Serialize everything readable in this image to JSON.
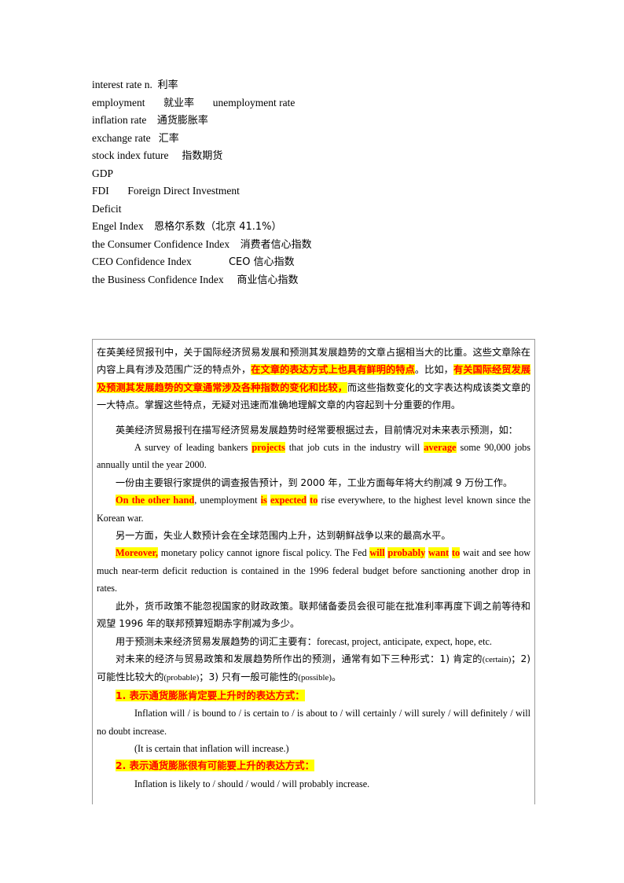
{
  "document": {
    "vocabulary": {
      "lines": [
        {
          "en": "interest rate n.",
          "sep": "  ",
          "cn": "利率",
          "tail_en": ""
        },
        {
          "en": "employment",
          "sep": "       ",
          "cn": "就业率",
          "tail_en": "       unemployment rate"
        },
        {
          "en": "inflation rate",
          "sep": "    ",
          "cn": "通货膨胀率",
          "tail_en": ""
        },
        {
          "en": "exchange rate",
          "sep": "   ",
          "cn": "汇率",
          "tail_en": ""
        },
        {
          "en": "stock index future",
          "sep": "     ",
          "cn": "指数期货",
          "tail_en": ""
        },
        {
          "en": "GDP",
          "sep": "",
          "cn": "",
          "tail_en": ""
        },
        {
          "en": "FDI",
          "sep": "       ",
          "cn": "",
          "tail_en": "Foreign Direct Investment"
        },
        {
          "en": "Deficit",
          "sep": "",
          "cn": "",
          "tail_en": ""
        },
        {
          "en": "Engel Index",
          "sep": "    ",
          "cn": "恩格尔系数（北京 41.1%）",
          "tail_en": ""
        },
        {
          "en": "the Consumer Confidence Index",
          "sep": "    ",
          "cn": "消费者信心指数",
          "tail_en": ""
        },
        {
          "en": "CEO Confidence Index",
          "sep": "              ",
          "cn": "CEO 信心指数",
          "tail_en": ""
        },
        {
          "en": "the Business Confidence Index",
          "sep": "     ",
          "cn": "商业信心指数",
          "tail_en": ""
        }
      ]
    },
    "article": {
      "para1": {
        "seg1": "在英美经贸报刊中，关于国际经济贸易发展和预测其发展趋势的文章占据相当大的比重。这些文章除在内容上具有涉及范围广泛的特点外，",
        "hl1": "在文章的表达方式上也具有鲜明的特点",
        "seg2": "。比如，",
        "hl2": "有关国际经贸发展及预测其发展趋势的文章通常涉及各种指数的变化和比较，",
        "seg3": "而这些指数变化的文字表达构成该类文章的一大特点。掌握这些特点，无疑对迅速而准确地理解文章的内容起到十分重要的作用。"
      },
      "para2": "英美经济贸易报刊在描写经济贸易发展趋势时经常要根据过去，目前情况对未来表示预测，如：",
      "example1": {
        "seg1": "A survey of leading bankers ",
        "hl1": "projects",
        "seg2": " that job cuts in the industry will ",
        "hl2": "average",
        "seg3": " some 90,000 jobs annually until the year 2000."
      },
      "example1_cn": "一份由主要银行家提供的调查报告预计，到 2000 年，工业方面每年将大约削减 9 万份工作。",
      "example2": {
        "hl1": "On the other hand",
        "seg1": ", unemployment ",
        "hl2": "is",
        "seg2": " ",
        "hl3": "expected",
        "seg3": " ",
        "hl4": "to",
        "seg4": " rise everywhere, to the highest level known since the Korean war."
      },
      "example2_cn": "另一方面，失业人数预计会在全球范围内上升，达到朝鲜战争以来的最高水平。",
      "example3": {
        "hl1": "Moreover,",
        "seg1": " monetary policy cannot ignore fiscal policy. The Fed ",
        "hl2": "will",
        "seg2": " ",
        "hl3": "probably",
        "seg3": " ",
        "hl4": "want",
        "seg4": " ",
        "hl5": "to",
        "seg5": " wait and see how much near-term deficit reduction is contained in the 1996 federal budget before sanctioning another drop in rates."
      },
      "example3_cn": "此外，货币政策不能忽视国家的财政政策。联邦储备委员会很可能在批准利率再度下调之前等待和观望 1996 年的联邦预算短期赤字削减为多少。",
      "para_vocab": {
        "cn": "用于预测未来经济贸易发展趋势的词汇主要有：",
        "en": "forecast, project, anticipate, expect, hope, etc."
      },
      "para_forms": {
        "seg1": "对未来的经济与贸易政策和发展趋势所作出的预测，通常有如下三种形式：1) 肯定的",
        "en1": "(certain)",
        "seg2": "；2) 可能性比较大的",
        "en2": "(probable)",
        "seg3": "；3) 只有一般可能性的",
        "en3": "(possible)",
        "seg4": "。"
      },
      "heading1": "1. 表示通货膨胀肯定要上升时的表达方式：",
      "list1": "Inflation will / is bound to / is certain to / is about to / will certainly / will surely / will definitely / will no doubt increase.",
      "list1_note": "(It is certain that inflation will increase.)",
      "heading2": "2. 表示通货膨胀很有可能要上升的表达方式：",
      "list2": "Inflation is likely to / should / would / will probably increase."
    },
    "colors": {
      "highlight_bg": "#ffff00",
      "highlight_text": "#ff0000",
      "border": "#9a9a9a",
      "text": "#000000",
      "page_bg": "#ffffff"
    }
  }
}
